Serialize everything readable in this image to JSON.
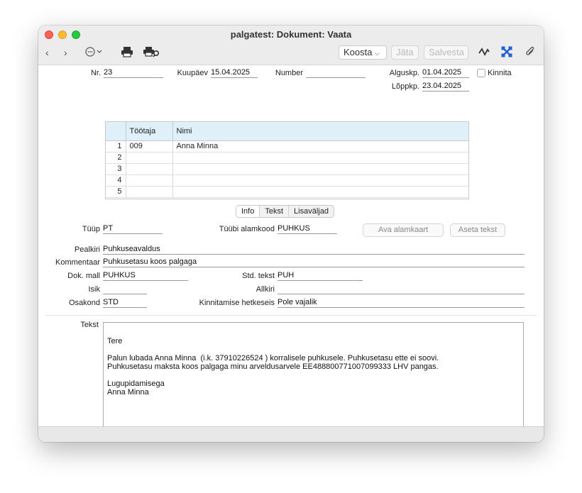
{
  "window": {
    "title": "palgatest: Dokument: Vaata"
  },
  "toolbar": {
    "koosta_label": "Koosta",
    "jata_label": "Jäta",
    "salvesta_label": "Salvesta"
  },
  "header": {
    "nr_label": "Nr.",
    "nr_value": "23",
    "kuupaev_label": "Kuupäev",
    "kuupaev_value": "15.04.2025",
    "number_label": "Number",
    "number_value": "",
    "alguskp_label": "Alguskp.",
    "alguskp_value": "01.04.2025",
    "loppkp_label": "Lõppkp.",
    "loppkp_value": "23.04.2025",
    "kinnita_label": "Kinnita"
  },
  "grid": {
    "columns": [
      "Töötaja",
      "Nimi"
    ],
    "rows": [
      {
        "n": "1",
        "tootaja": "009",
        "nimi": "Anna Minna"
      },
      {
        "n": "2",
        "tootaja": "",
        "nimi": ""
      },
      {
        "n": "3",
        "tootaja": "",
        "nimi": ""
      },
      {
        "n": "4",
        "tootaja": "",
        "nimi": ""
      },
      {
        "n": "5",
        "tootaja": "",
        "nimi": ""
      }
    ]
  },
  "tabs": [
    {
      "label": "Info",
      "selected": true
    },
    {
      "label": "Tekst",
      "selected": false
    },
    {
      "label": "Lisaväljad",
      "selected": false
    }
  ],
  "info": {
    "tyyp_label": "Tüüp",
    "tyyp_value": "PT",
    "alamkood_label": "Tüübi alamkood",
    "alamkood_value": "PUHKUS",
    "ava_alamkaart_label": "Ava alamkaart",
    "aseta_tekst_label": "Aseta tekst",
    "pealkiri_label": "Pealkiri",
    "pealkiri_value": "Puhkuseavaldus",
    "kommentaar_label": "Kommentaar",
    "kommentaar_value": "Puhkusetasu koos palgaga",
    "dokmall_label": "Dok. mall",
    "dokmall_value": "PUHKUS",
    "stdtekst_label": "Std. tekst",
    "stdtekst_value": "PUH",
    "isik_label": "Isik",
    "isik_value": "",
    "allkiri_label": "Allkiri",
    "allkiri_value": "",
    "osakond_label": "Osakond",
    "osakond_value": "STD",
    "hetkeseis_label": "Kinnitamise hetkeseis",
    "hetkeseis_value": "Pole vajalik"
  },
  "tekst": {
    "label": "Tekst",
    "lines": [
      "Tere",
      "",
      "Palun lubada Anna Minna  (i.k. 37910226524 ) korralisele puhkusele. Puhkusetasu ette ei soovi.",
      "Puhkusetasu maksta koos palgaga minu arveldusarvele EE488800771007099333 LHV pangas.",
      "",
      "Lugupidamisega",
      "Anna Minna"
    ]
  }
}
